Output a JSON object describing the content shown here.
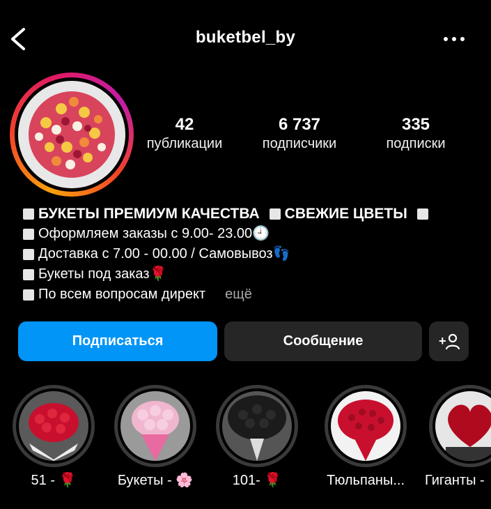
{
  "header": {
    "username": "buketbel_by",
    "back_icon": "chevron-left-icon",
    "more_icon": "more-horizontal-icon"
  },
  "stats": [
    {
      "value": "42",
      "label": "публикации"
    },
    {
      "value": "6 737",
      "label": "подписчики"
    },
    {
      "value": "335",
      "label": "подписки"
    }
  ],
  "bio": {
    "line1_a": "БУКЕТЫ ПРЕМИУМ КАЧЕСТВА",
    "line1_b": "СВЕЖИЕ ЦВЕТЫ",
    "line2": "Оформляем заказы с 9.00- 23.00🕘",
    "line3": "Доставка с 7.00 - 00.00 / Самовывоз👣",
    "line4": "Букеты под заказ🌹",
    "line5": "По всем вопросам директ",
    "more": "ещё"
  },
  "buttons": {
    "follow": "Подписаться",
    "message": "Сообщение",
    "add_user_glyph": "+"
  },
  "highlights": [
    {
      "label": "51 - 🌹"
    },
    {
      "label": "Букеты - 🌸"
    },
    {
      "label": "101- 🌹"
    },
    {
      "label": "Тюльпаны..."
    },
    {
      "label": "Гиганты -"
    }
  ],
  "colors": {
    "background": "#000000",
    "primary_button": "#0095f6",
    "secondary_button": "#262626",
    "muted_text": "#a8a8a8"
  }
}
